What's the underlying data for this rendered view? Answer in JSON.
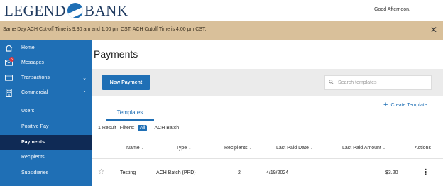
{
  "header": {
    "logo_text_left": "LEGEND",
    "logo_text_right": "BANK",
    "greeting": "Good Afternoon,"
  },
  "banner": {
    "text": "Same Day ACH Cut-off Time is 9:30 am and 1:00 pm CST. ACH Cutoff Time is 4:00 pm CST.",
    "close": "✕",
    "color": "#d9c09a"
  },
  "sidebar": {
    "color": "#1f6fb5",
    "active_color": "#0f2a55",
    "items": [
      {
        "label": "Home",
        "icon": "home-icon"
      },
      {
        "label": "Messages",
        "icon": "envelope-icon",
        "badge": "5"
      },
      {
        "label": "Transactions",
        "icon": "card-icon",
        "chevron": "⌄"
      },
      {
        "label": "Commercial",
        "icon": "building-icon",
        "chevron": "⌃"
      },
      {
        "label": "Users"
      },
      {
        "label": "Positive Pay"
      },
      {
        "label": "Payments",
        "active": true
      },
      {
        "label": "Recipients"
      },
      {
        "label": "Subsidiaries"
      }
    ]
  },
  "main": {
    "title": "Payments",
    "new_payment": "New Payment",
    "search_placeholder": "Search templates",
    "tab": "Templates",
    "create_template": "Create Template",
    "result_count": "1 Result",
    "filters_label": "Filters:",
    "filter_all": "All",
    "filter_ach": "ACH Batch",
    "columns": [
      "Name",
      "Type",
      "Recipients",
      "Last Paid Date",
      "Last Paid Amount",
      "Actions"
    ],
    "rows": [
      {
        "name": "Testing",
        "type": "ACH Batch (PPD)",
        "recipients": "2",
        "last_paid_date": "4/19/2024",
        "last_paid_amount": "$3.20"
      }
    ]
  }
}
